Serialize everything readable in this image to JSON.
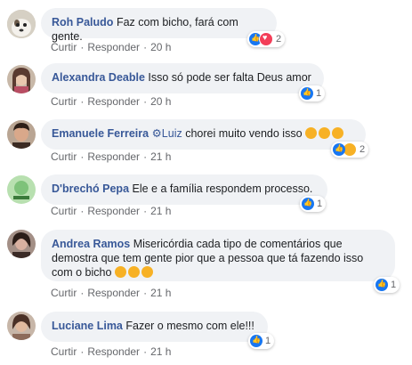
{
  "comments": [
    {
      "author": "Roh Paludo",
      "text": "Faz com bicho, fará com gente.",
      "actions": {
        "like": "Curtir",
        "reply": "Responder",
        "time": "20 h"
      },
      "reaction_count": "2",
      "avatar_color": "#c9c2b5"
    },
    {
      "author": "Alexandra Deable",
      "text": "Isso só pode ser falta Deus amor",
      "actions": {
        "like": "Curtir",
        "reply": "Responder",
        "time": "20 h"
      },
      "reaction_count": "1",
      "avatar_color": "#8a5a52"
    },
    {
      "author": "Emanuele Ferreira",
      "mention": "Luiz",
      "text": "chorei muito vendo isso",
      "actions": {
        "like": "Curtir",
        "reply": "Responder",
        "time": "21 h"
      },
      "reaction_count": "2",
      "avatar_color": "#7a5a46"
    },
    {
      "author": "D'brechó Pepa",
      "text": "Ele e a família respondem processo.",
      "actions": {
        "like": "Curtir",
        "reply": "Responder",
        "time": "21 h"
      },
      "reaction_count": "1",
      "avatar_color": "#a6d9a0"
    },
    {
      "author": "Andrea Ramos",
      "text_lines": [
        "Misericórdia cada tipo de comentários que",
        "demostra que tem gente pior que a pessoa que tá fazendo isso",
        "com o bicho"
      ],
      "actions": {
        "like": "Curtir",
        "reply": "Responder",
        "time": "21 h"
      },
      "reaction_count": "1",
      "avatar_color": "#5c4a44"
    },
    {
      "author": "Luciane Lima",
      "text": "Fazer o mesmo com ele!!!",
      "actions": {
        "like": "Curtir",
        "reply": "Responder",
        "time": "21 h"
      },
      "reaction_count": "1",
      "avatar_color": "#6d5546"
    }
  ],
  "separator": "·",
  "colors": {
    "author": "#385898",
    "bubble": "#f0f2f5",
    "meta": "#65676b",
    "like": "#1877f2",
    "love": "#f33e58",
    "emoji": "#f7b125"
  },
  "icons": [
    "like-icon",
    "love-icon",
    "sad-icon",
    "gear-icon",
    "crying-emoji-icon",
    "laughing-emoji-icon"
  ]
}
